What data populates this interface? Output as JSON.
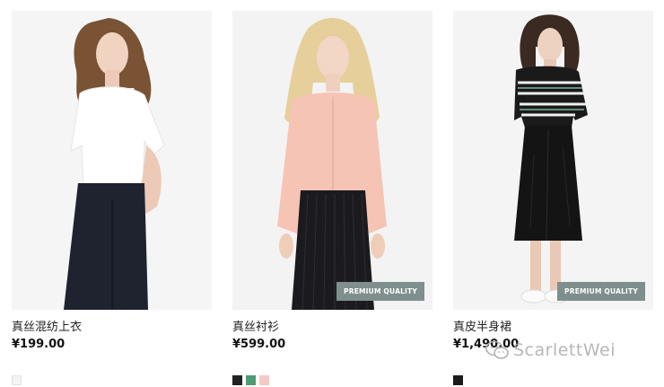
{
  "products": [
    {
      "name": "真丝混纺上衣",
      "price": "¥199.00",
      "badge": "",
      "swatches": [
        {
          "color": "#f4f4f4",
          "border": "#e2e2e2"
        }
      ]
    },
    {
      "name": "真丝衬衫",
      "price": "¥599.00",
      "badge": "PREMIUM QUALITY",
      "swatches": [
        {
          "color": "#222222",
          "border": "#222222"
        },
        {
          "color": "#4e9c72",
          "border": "#4e9c72"
        },
        {
          "color": "#f5c9c4",
          "border": "#f5c9c4"
        }
      ]
    },
    {
      "name": "真皮半身裙",
      "price": "¥1,490.00",
      "badge": "PREMIUM QUALITY",
      "swatches": [
        {
          "color": "#1c1c1c",
          "border": "#1c1c1c"
        }
      ]
    }
  ],
  "watermark": {
    "text": "ScarlettWei",
    "icon": "wechat-icon"
  }
}
